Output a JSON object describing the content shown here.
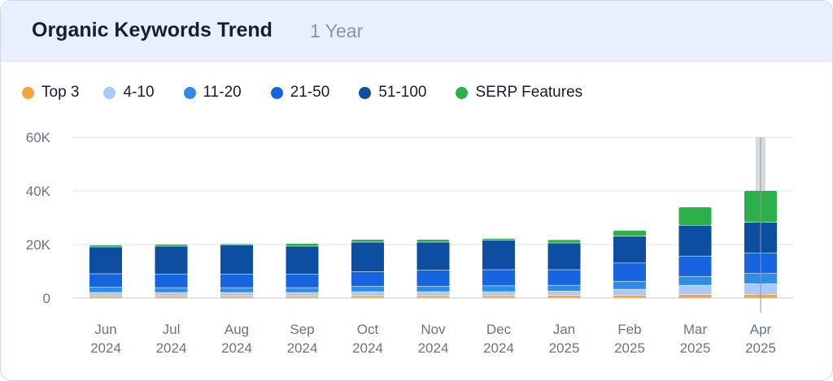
{
  "header": {
    "title": "Organic Keywords Trend",
    "period": "1 Year"
  },
  "legend": [
    {
      "label": "Top 3",
      "color": "#f7a23b"
    },
    {
      "label": "4-10",
      "color": "#a9c9f7"
    },
    {
      "label": "11-20",
      "color": "#2f8de8"
    },
    {
      "label": "21-50",
      "color": "#1764e0"
    },
    {
      "label": "51-100",
      "color": "#0d4ea0"
    },
    {
      "label": "SERP Features",
      "color": "#2bb04a"
    }
  ],
  "chart_data": {
    "type": "bar",
    "stacked": true,
    "categories": [
      [
        "Jun",
        "2024"
      ],
      [
        "Jul",
        "2024"
      ],
      [
        "Aug",
        "2024"
      ],
      [
        "Sep",
        "2024"
      ],
      [
        "Oct",
        "2024"
      ],
      [
        "Nov",
        "2024"
      ],
      [
        "Dec",
        "2024"
      ],
      [
        "Jan",
        "2025"
      ],
      [
        "Feb",
        "2025"
      ],
      [
        "Mar",
        "2025"
      ],
      [
        "Apr",
        "2025"
      ]
    ],
    "y_ticks": [
      "0",
      "20K",
      "40K",
      "60K"
    ],
    "ylim": [
      0,
      60000
    ],
    "grid": true,
    "legend_position": "top-left",
    "highlighted_category": "Apr 2025",
    "series": [
      {
        "name": "Top 3",
        "color": "#f7a23b",
        "values": [
          700,
          700,
          700,
          700,
          800,
          800,
          800,
          900,
          1000,
          1200,
          1300
        ]
      },
      {
        "name": "4-10",
        "color": "#a9c9f7",
        "values": [
          1300,
          1300,
          1300,
          1300,
          1500,
          1500,
          1500,
          1600,
          2200,
          3500,
          4000
        ]
      },
      {
        "name": "11-20",
        "color": "#2f8de8",
        "values": [
          2000,
          1800,
          1800,
          1800,
          2000,
          2000,
          2200,
          2200,
          3000,
          3300,
          3800
        ]
      },
      {
        "name": "21-50",
        "color": "#1764e0",
        "values": [
          5000,
          5000,
          5000,
          5000,
          5500,
          6000,
          6000,
          5800,
          6800,
          7600,
          7600
        ]
      },
      {
        "name": "51-100",
        "color": "#0d4ea0",
        "values": [
          10000,
          10500,
          11000,
          10500,
          11000,
          10500,
          11000,
          10000,
          10000,
          11500,
          11500
        ]
      },
      {
        "name": "SERP Features",
        "color": "#2bb04a",
        "values": [
          700,
          700,
          400,
          1000,
          1000,
          1000,
          700,
          1200,
          2200,
          6800,
          11800
        ]
      }
    ]
  }
}
